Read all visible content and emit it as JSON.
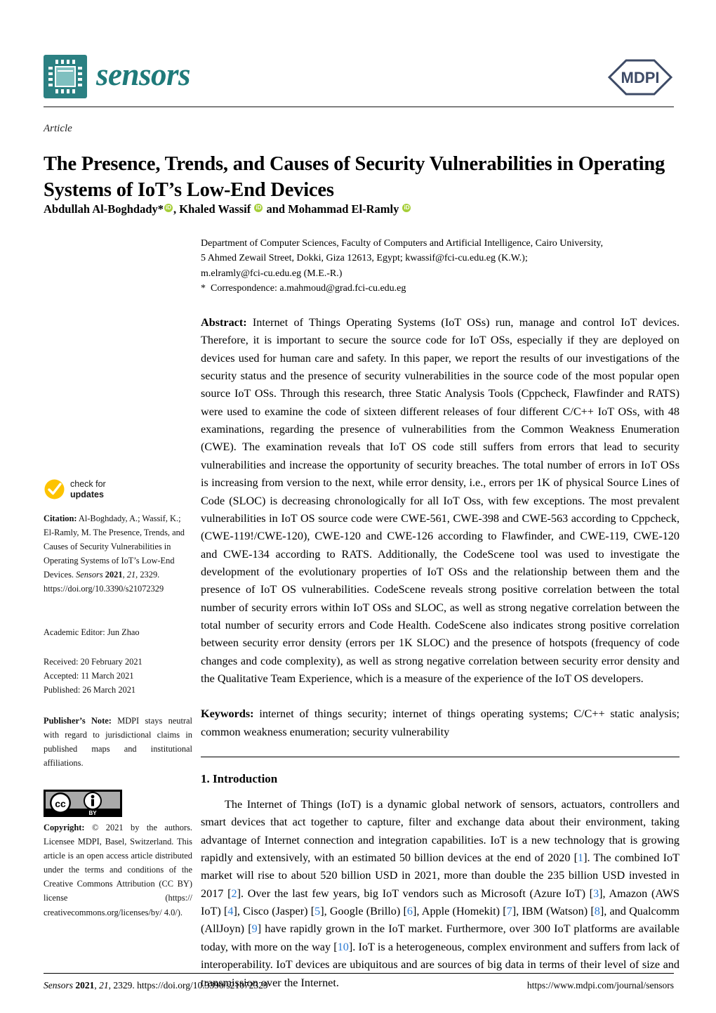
{
  "journal": {
    "name": "sensors",
    "logo_icon": "chip-icon",
    "publisher_logo_text": "MDPI",
    "brand_color": "#1f7a7a",
    "publisher_color": "#3d4a66"
  },
  "article": {
    "type": "Article",
    "title": "The Presence, Trends, and Causes of Security Vulnerabilities in Operating Systems of IoT’s Low-End Devices",
    "authors": [
      {
        "name": "Abdullah Al-Boghdady",
        "corresponding_mark": "*",
        "orcid": "orcid-icon",
        "separator": ", "
      },
      {
        "name": "Khaled Wassif",
        "corresponding_mark": "",
        "orcid": "orcid-icon",
        "separator": " and "
      },
      {
        "name": "Mohammad El-Ramly",
        "corresponding_mark": "",
        "orcid": "orcid-icon",
        "separator": ""
      }
    ],
    "affiliation_lines": [
      "Department of Computer Sciences, Faculty of Computers and Artificial Intelligence, Cairo University,",
      "5 Ahmed Zewail Street, Dokki, Giza 12613, Egypt; kwassif@fci-cu.edu.eg (K.W.);",
      "m.elramly@fci-cu.edu.eg (M.E.-R.)"
    ],
    "correspondence_star": "*",
    "correspondence": "Correspondence: a.mahmoud@grad.fci-cu.edu.eg",
    "abstract_label": "Abstract:",
    "abstract_text": " Internet of Things Operating Systems (IoT OSs) run, manage and control IoT devices. Therefore, it is important to secure the source code for IoT OSs, especially if they are deployed on devices used for human care and safety. In this paper, we report the results of our investigations of the security status and the presence of security vulnerabilities in the source code of the most popular open source IoT OSs. Through this research, three Static Analysis Tools (Cppcheck, Flawfinder and RATS) were used to examine the code of sixteen different releases of four different C/C++ IoT OSs, with 48 examinations, regarding the presence of vulnerabilities from the Common Weakness Enumeration (CWE). The examination reveals that IoT OS code still suffers from errors that lead to security vulnerabilities and increase the opportunity of security breaches. The total number of errors in IoT OSs is increasing from version to the next, while error density, i.e., errors per 1K of physical Source Lines of Code (SLOC) is decreasing chronologically for all IoT Oss, with few exceptions. The most prevalent vulnerabilities in IoT OS source code were CWE-561, CWE-398 and CWE-563 according to Cppcheck, (CWE-119!/CWE-120), CWE-120 and CWE-126 according to Flawfinder, and CWE-119, CWE-120 and CWE-134 according to RATS. Additionally, the CodeScene tool was used to investigate the development of the evolutionary properties of IoT OSs and the relationship between them and the presence of IoT OS vulnerabilities. CodeScene reveals strong positive correlation between the total number of security errors within IoT OSs and SLOC, as well as strong negative correlation between the total number of security errors and Code Health. CodeScene also indicates strong positive correlation between security error density (errors per 1K SLOC) and the presence of hotspots (frequency of code changes and code complexity), as well as strong negative correlation between security error density and the Qualitative Team Experience, which is a measure of the experience of the IoT OS developers.",
    "keywords_label": "Keywords:",
    "keywords_text": " internet of things security; internet of things operating systems; C/C++ static analysis; common weakness enumeration; security vulnerability"
  },
  "sections": [
    {
      "heading": "1. Introduction",
      "paragraph_parts": [
        {
          "t": "text",
          "v": "The Internet of Things (IoT) is a dynamic global network of sensors, actuators, controllers and smart devices that act together to capture, filter and exchange data about their environment, taking advantage of Internet connection and integration capabilities. IoT is a new technology that is growing rapidly and extensively, with an estimated 50 billion devices at the end of 2020 ["
        },
        {
          "t": "cite",
          "v": "1"
        },
        {
          "t": "text",
          "v": "]. The combined IoT market will rise to about 520 billion USD in 2021, more than double the 235 billion USD invested in 2017 ["
        },
        {
          "t": "cite",
          "v": "2"
        },
        {
          "t": "text",
          "v": "]. Over the last few years, big IoT vendors such as Microsoft (Azure IoT) ["
        },
        {
          "t": "cite",
          "v": "3"
        },
        {
          "t": "text",
          "v": "], Amazon (AWS IoT) ["
        },
        {
          "t": "cite",
          "v": "4"
        },
        {
          "t": "text",
          "v": "], Cisco (Jasper) ["
        },
        {
          "t": "cite",
          "v": "5"
        },
        {
          "t": "text",
          "v": "], Google (Brillo) ["
        },
        {
          "t": "cite",
          "v": "6"
        },
        {
          "t": "text",
          "v": "], Apple (Homekit) ["
        },
        {
          "t": "cite",
          "v": "7"
        },
        {
          "t": "text",
          "v": "], IBM (Watson) ["
        },
        {
          "t": "cite",
          "v": "8"
        },
        {
          "t": "text",
          "v": "], and Qualcomm (AllJoyn) ["
        },
        {
          "t": "cite",
          "v": "9"
        },
        {
          "t": "text",
          "v": "] have rapidly grown in the IoT market. Furthermore, over 300 IoT platforms are available today, with more on the way ["
        },
        {
          "t": "cite",
          "v": "10"
        },
        {
          "t": "text",
          "v": "]. IoT is a heterogeneous, complex environment and suffers from lack of interoperability. IoT devices are ubiquitous and are sources of big data in terms of their level of size and transmission over the Internet."
        }
      ]
    }
  ],
  "sidebar": {
    "check_for_updates": {
      "icon": "check-circle-icon",
      "line1": "check for",
      "line2": "updates",
      "color": "#fdc300"
    },
    "citation": {
      "label": "Citation:",
      "text": " Al-Boghdady, A.; Wassif, K.; El-Ramly, M. The Presence, Trends, and Causes of Security Vulnerabilities in Operating Systems of IoT’s Low-End Devices. ",
      "journal_italic": "Sensors",
      "year_bold": "2021",
      "volume_italic": "21",
      "pages": "2329",
      "doi_line1": "https://doi.org/",
      "doi_line2": "10.3390/s21072329"
    },
    "academic_editor": "Academic Editor: Jun Zhao",
    "dates": [
      "Received: 20 February 2021",
      "Accepted: 11 March 2021",
      "Published: 26 March 2021"
    ],
    "publisher_note": {
      "label": "Publisher’s Note:",
      "text": " MDPI stays neutral with regard to jurisdictional claims in published maps and institutional affiliations."
    },
    "cc_badge": {
      "icon": "creative-commons-by-icon",
      "cc_text": "cc",
      "by_text": "BY"
    },
    "copyright": {
      "label": "Copyright:",
      "text": " © 2021 by the authors. Licensee MDPI, Basel, Switzerland. This article is an open access article distributed under the terms and conditions of the Creative Commons Attribution (CC BY) license (https:// creativecommons.org/licenses/by/ 4.0/)."
    }
  },
  "footer": {
    "left_journal_italic": "Sensors",
    "left_year_bold": "2021",
    "left_volume_italic": "21",
    "left_rest": ", 2329. https://doi.org/10.3390/s21072329",
    "right": "https://www.mdpi.com/journal/sensors"
  }
}
